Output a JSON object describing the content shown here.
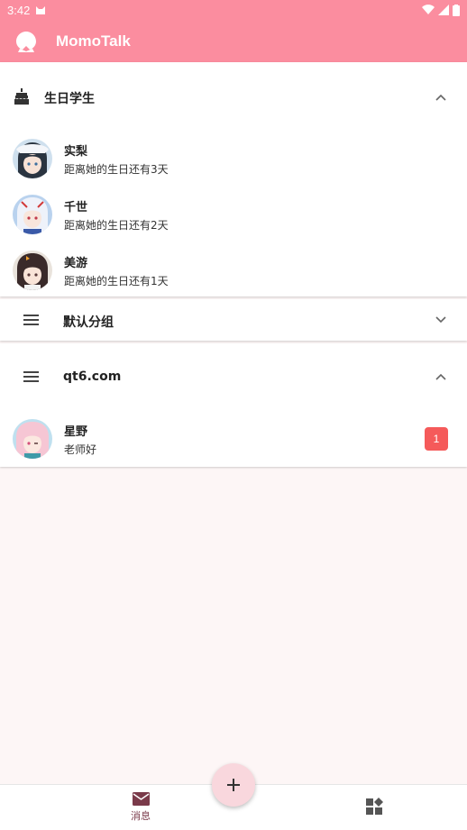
{
  "status_bar": {
    "time": "3:42"
  },
  "app_bar": {
    "title": "MomoTalk"
  },
  "groups": {
    "birthday": {
      "title": "生日学生",
      "students": [
        {
          "name": "实梨",
          "note": "距离她的生日还有3天"
        },
        {
          "name": "千世",
          "note": "距离她的生日还有2天"
        },
        {
          "name": "美游",
          "note": "距离她的生日还有1天"
        }
      ]
    },
    "default": {
      "title": "默认分组"
    },
    "qt6": {
      "title": "qt6.com",
      "chats": [
        {
          "name": "星野",
          "last_message": "老师好",
          "unread": "1"
        }
      ]
    }
  },
  "bottom_nav": {
    "messages_label": "消息"
  },
  "colors": {
    "primary": "#fb8d9f",
    "badge": "#f55a5a",
    "fab": "#f9d7dd",
    "background": "#fdf6f6"
  }
}
